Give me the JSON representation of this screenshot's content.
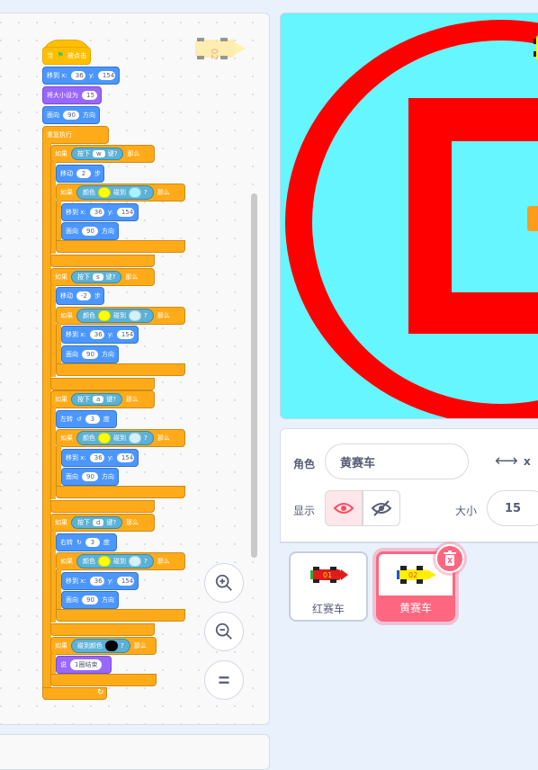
{
  "code": {
    "hat": {
      "flag_label": "当",
      "event_label": "被点击"
    },
    "init": {
      "goto_label": "移到 x:",
      "goto_x": "36",
      "goto_y_label": "y:",
      "goto_y": "154",
      "size_label": "将大小设为",
      "size_value": "15",
      "dir_label": "面向",
      "dir_value": "90",
      "dir_suffix": "方向"
    },
    "forever_label": "重复执行",
    "if_label": "如果",
    "then_label": "那么",
    "key_pressed_prefix": "按下",
    "key_pressed_suffix": "键?",
    "touching_color_prefix": "颜色",
    "touching_color_middle": "碰到",
    "touching_color_suffix": "?",
    "goto_label": "移到 x:",
    "goto_x": "36",
    "goto_y_label": "y:",
    "goto_y": "154",
    "face_label": "面向",
    "face_value": "90",
    "face_suffix": "方向",
    "block_w": {
      "key": "w",
      "action_label": "移动",
      "action_value": "2",
      "action_suffix": "步"
    },
    "block_s": {
      "key": "s",
      "action_label": "移动",
      "action_value": "-2",
      "action_suffix": "步"
    },
    "block_a": {
      "key": "a",
      "action_label": "左转",
      "action_value": "3",
      "action_suffix": "度"
    },
    "block_d": {
      "key": "d",
      "action_label": "右转",
      "action_value": "3",
      "action_suffix": "度"
    },
    "final": {
      "if_label": "如果",
      "touching_label": "碰到颜色",
      "q": "?",
      "then_label": "那么",
      "say_label": "说",
      "say_value": "1圈结束"
    }
  },
  "colors": {
    "yellow": "#ffff00",
    "light_cyan": "#b3f0ff",
    "light_cyan2": "#d2f1fb",
    "black": "#000000",
    "stage_bg": "#66f6ff",
    "track_red": "#ff0000"
  },
  "sprite_info": {
    "sprite_label": "角色",
    "sprite_name": "黄赛车",
    "x_label": "x",
    "show_label": "显示",
    "size_label": "大小",
    "size_value": "15"
  },
  "sprites": [
    {
      "name": "红赛车",
      "selected": false,
      "number": "01"
    },
    {
      "name": "黄赛车",
      "selected": true,
      "number": "02"
    }
  ]
}
